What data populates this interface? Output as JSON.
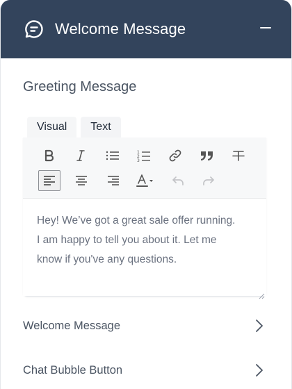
{
  "header": {
    "title": "Welcome Message",
    "icon": "chat-bubble-icon",
    "collapse_icon": "minus-icon",
    "bg_color": "#33445c"
  },
  "section": {
    "title": "Greeting Message"
  },
  "tabs": [
    {
      "label": "Visual"
    },
    {
      "label": "Text"
    }
  ],
  "editor": {
    "toolbar_row1": [
      "bold-icon",
      "italic-icon",
      "bulleted-list-icon",
      "numbered-list-icon",
      "link-icon",
      "blockquote-icon",
      "strikethrough-icon"
    ],
    "toolbar_row2": [
      "align-left-icon",
      "align-center-icon",
      "align-right-icon",
      "text-color-icon",
      "undo-icon",
      "redo-icon"
    ],
    "content_lines": [
      "Hey! We’ve got a great sale offer running.",
      "I am happy to tell you about it. Let me",
      "know if you've any questions."
    ]
  },
  "accordion": [
    {
      "label": "Welcome Message",
      "icon": "chevron-right-icon"
    },
    {
      "label": "Chat Bubble Button",
      "icon": "chevron-right-icon"
    }
  ]
}
